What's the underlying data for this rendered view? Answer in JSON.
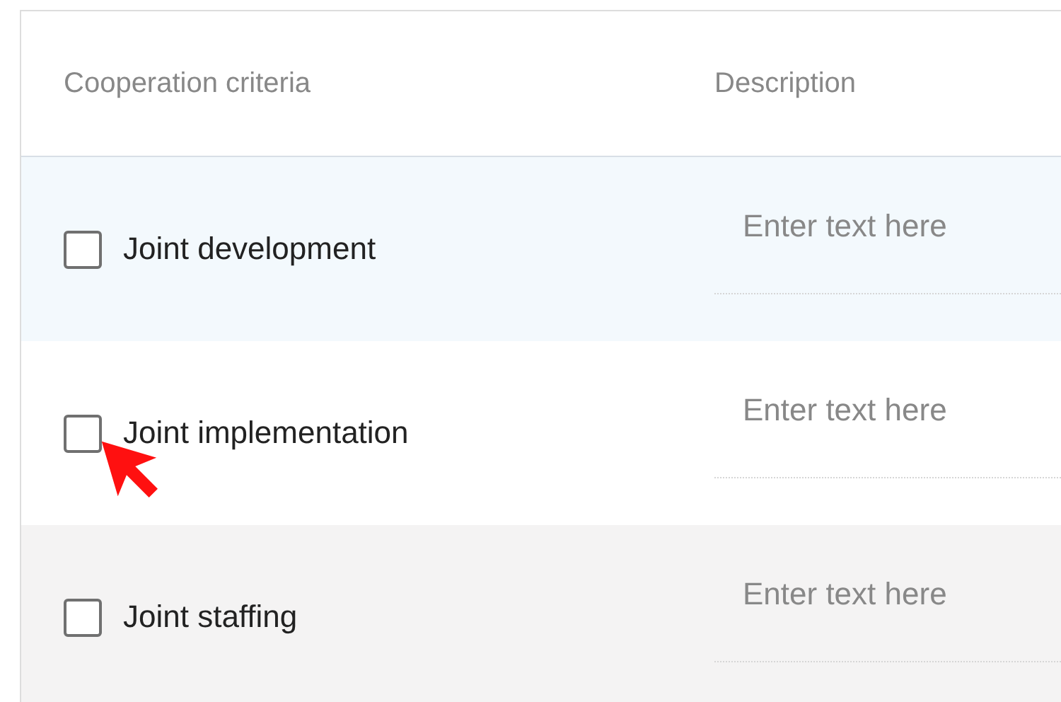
{
  "table": {
    "columns": [
      "Cooperation criteria",
      "Description"
    ],
    "rows": [
      {
        "label": "Joint development",
        "checked": false,
        "color": "#f3f9fd",
        "description": {
          "placeholder": "Enter text here"
        }
      },
      {
        "label": "Joint implementation",
        "checked": false,
        "color": "#ffffff",
        "description": {
          "placeholder": "Enter text here"
        }
      },
      {
        "label": "Joint staffing",
        "checked": false,
        "color": "#f4f3f3",
        "description": {
          "placeholder": "Enter text here"
        }
      }
    ]
  }
}
